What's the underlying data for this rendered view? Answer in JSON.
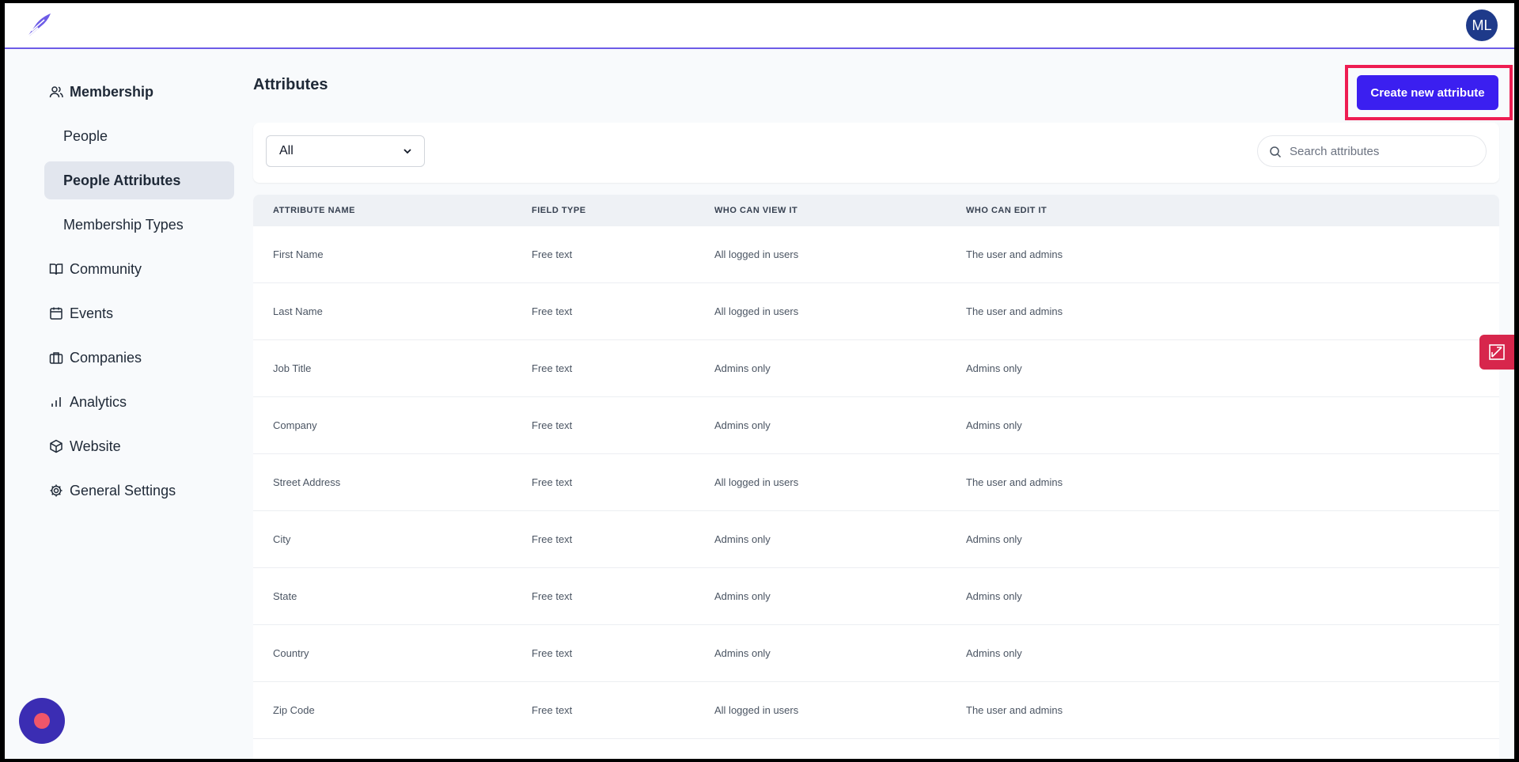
{
  "header": {
    "avatar_initials": "ML"
  },
  "sidebar": {
    "items": [
      {
        "label": "Membership",
        "icon": "users-icon"
      },
      {
        "label": "People"
      },
      {
        "label": "People Attributes"
      },
      {
        "label": "Membership Types"
      },
      {
        "label": "Community",
        "icon": "book-icon"
      },
      {
        "label": "Events",
        "icon": "calendar-icon"
      },
      {
        "label": "Companies",
        "icon": "briefcase-icon"
      },
      {
        "label": "Analytics",
        "icon": "bar-chart-icon"
      },
      {
        "label": "Website",
        "icon": "cube-icon"
      },
      {
        "label": "General Settings",
        "icon": "gear-icon"
      }
    ]
  },
  "main": {
    "title": "Attributes",
    "create_button_label": "Create new attribute",
    "filter_value": "All",
    "search_placeholder": "Search attributes"
  },
  "table": {
    "headers": [
      "ATTRIBUTE NAME",
      "FIELD TYPE",
      "WHO CAN VIEW IT",
      "WHO CAN EDIT IT"
    ],
    "rows": [
      [
        "First Name",
        "Free text",
        "All logged in users",
        "The user and admins"
      ],
      [
        "Last Name",
        "Free text",
        "All logged in users",
        "The user and admins"
      ],
      [
        "Job Title",
        "Free text",
        "Admins only",
        "Admins only"
      ],
      [
        "Company",
        "Free text",
        "Admins only",
        "Admins only"
      ],
      [
        "Street Address",
        "Free text",
        "All logged in users",
        "The user and admins"
      ],
      [
        "City",
        "Free text",
        "Admins only",
        "Admins only"
      ],
      [
        "State",
        "Free text",
        "Admins only",
        "Admins only"
      ],
      [
        "Country",
        "Free text",
        "Admins only",
        "Admins only"
      ],
      [
        "Zip Code",
        "Free text",
        "All logged in users",
        "The user and admins"
      ]
    ]
  },
  "colors": {
    "accent": "#3b1ff0",
    "highlight": "#ee1d52",
    "topbar_border": "#6d5ce7"
  }
}
